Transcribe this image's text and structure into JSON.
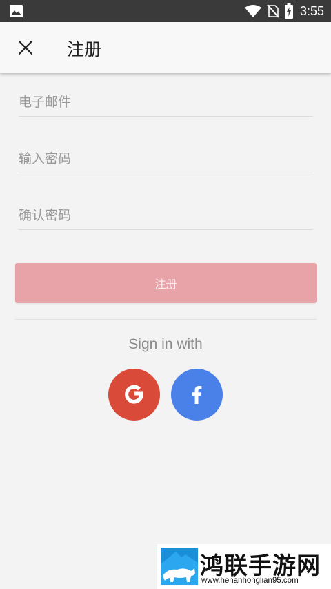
{
  "status_bar": {
    "time": "3:55",
    "icons": [
      "image-icon",
      "wifi-icon",
      "no-sim-icon",
      "battery-charging-icon"
    ]
  },
  "app_bar": {
    "title": "注册",
    "close_icon": "close-icon"
  },
  "form": {
    "email": {
      "value": "",
      "placeholder": "电子邮件"
    },
    "password": {
      "value": "",
      "placeholder": "输入密码"
    },
    "confirm_password": {
      "value": "",
      "placeholder": "确认密码"
    },
    "submit_label": "注册"
  },
  "social": {
    "label": "Sign in with",
    "google": {
      "glyph": "G",
      "color": "#d94a38"
    },
    "facebook": {
      "glyph": "f",
      "color": "#4a81e8"
    }
  },
  "watermark": {
    "title": "鸿联手游网",
    "url": "www.henanhonglian95.com"
  },
  "colors": {
    "primary_button": "#e8a3a9",
    "background": "#f3f3f3",
    "status_bar": "#3a3a3a"
  }
}
